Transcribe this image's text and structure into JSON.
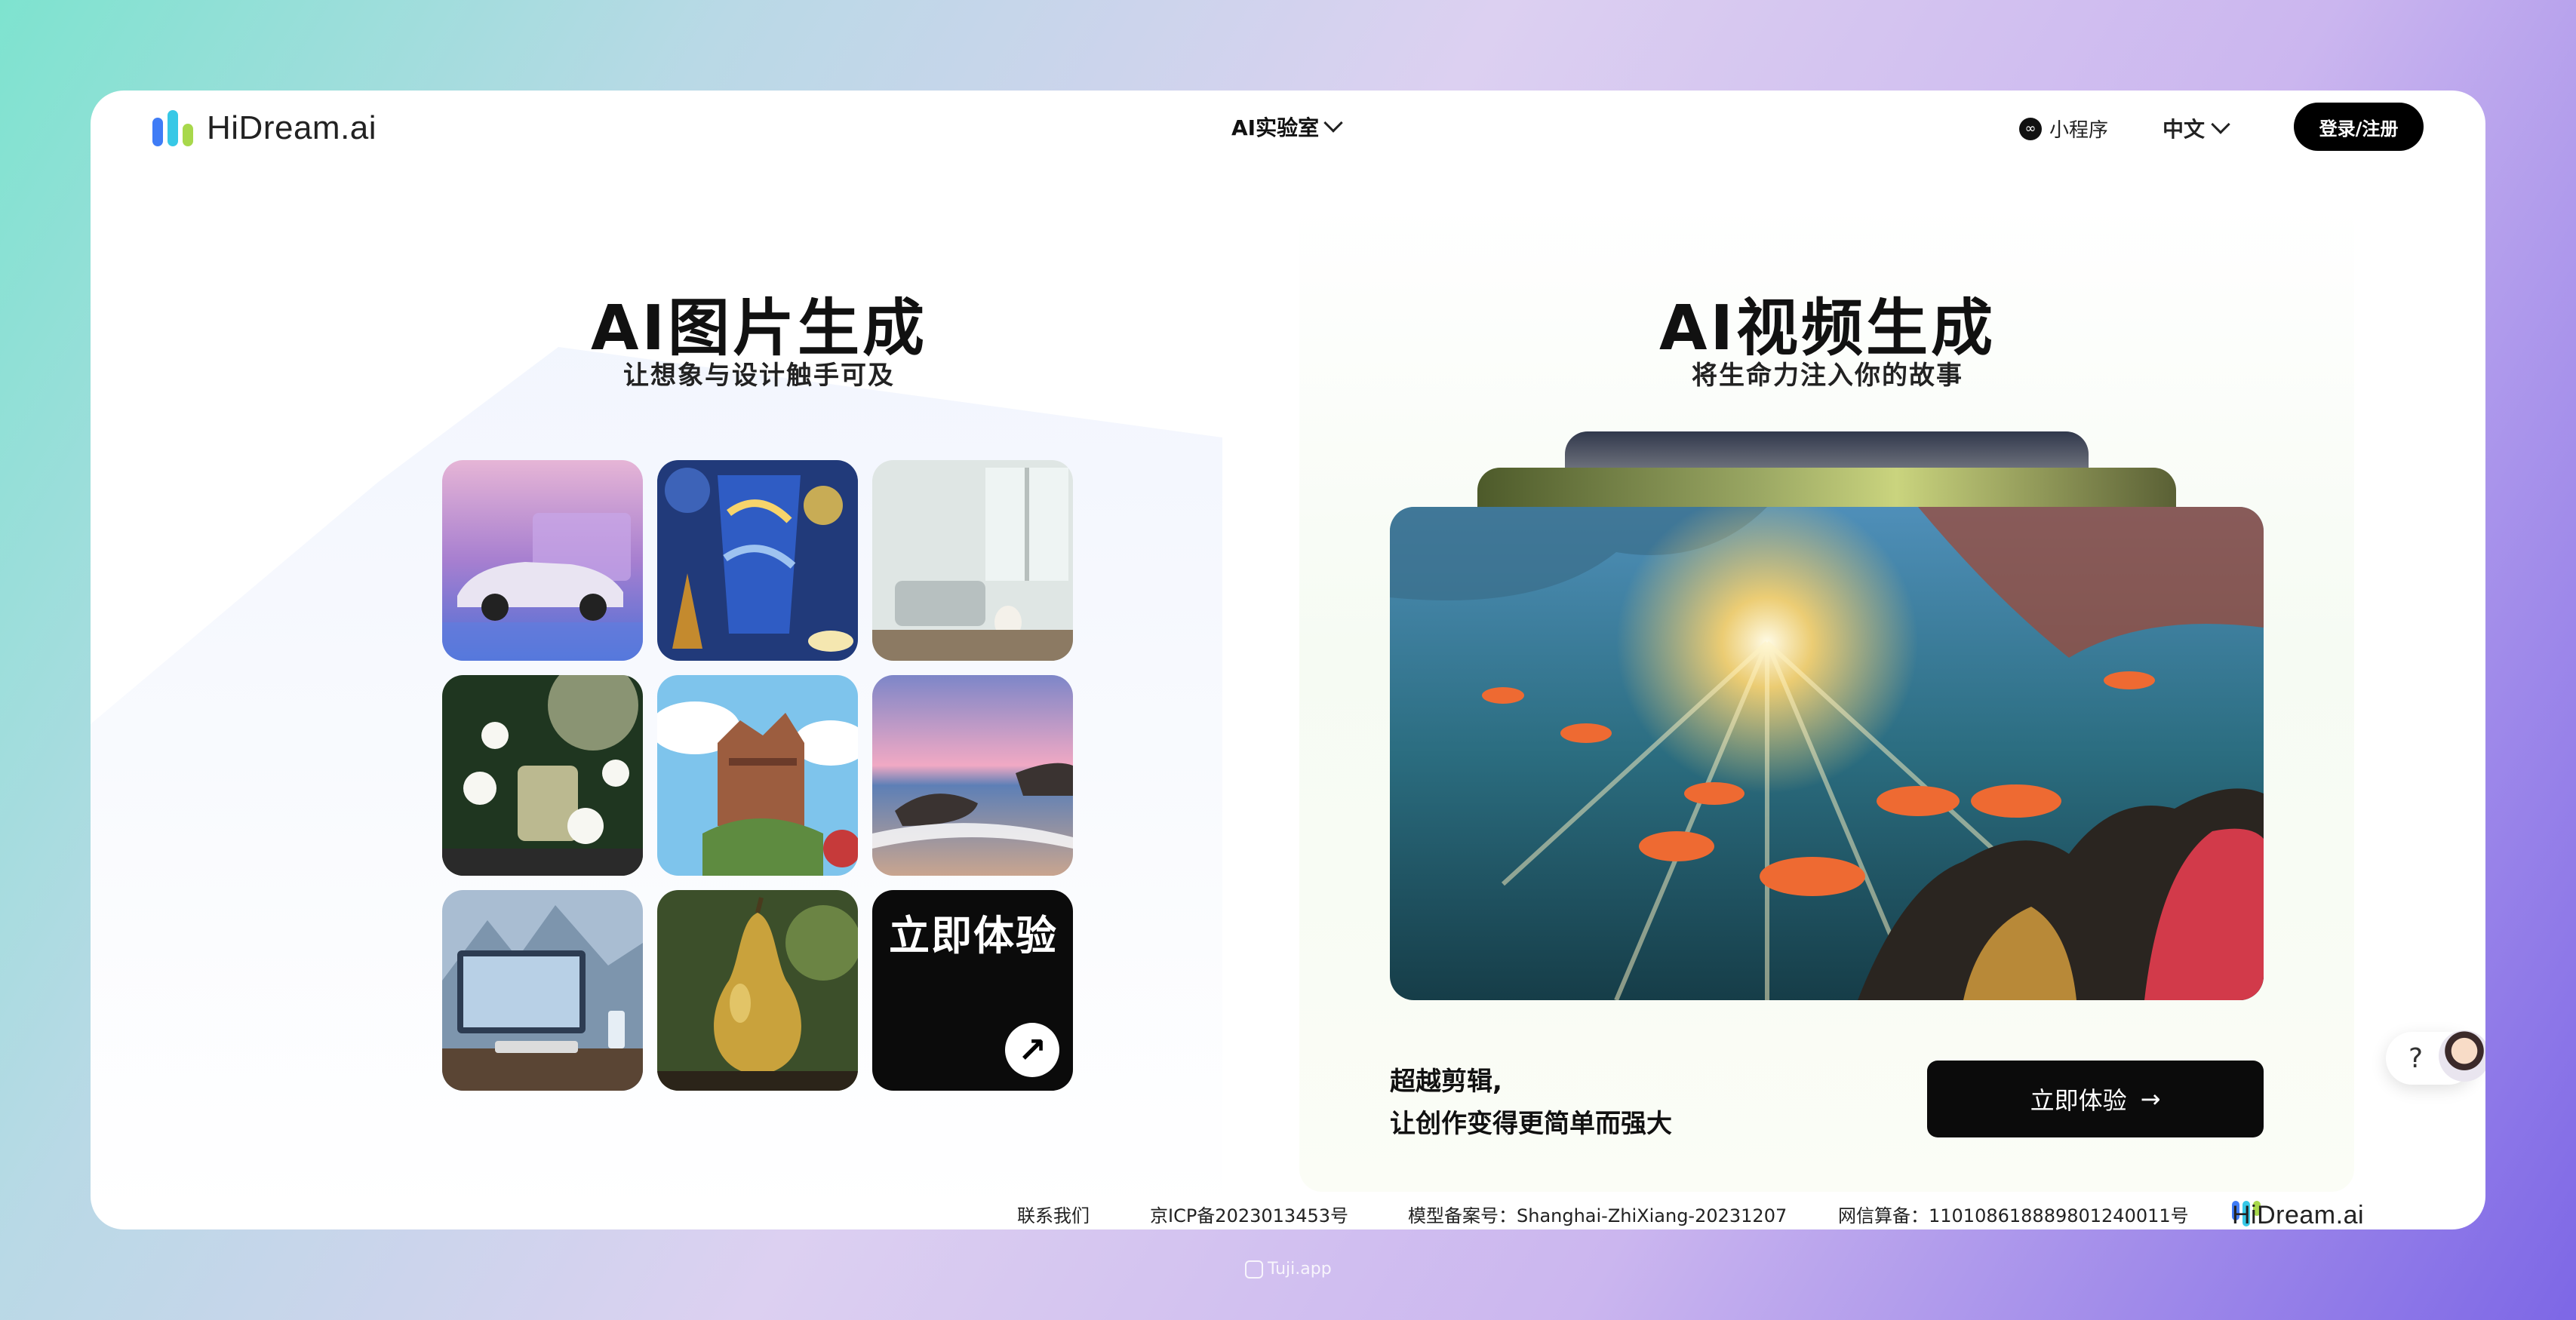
{
  "header": {
    "logo_text": "HiDream.ai",
    "nav_lab": "AI实验室",
    "mini_program": "小程序",
    "language": "中文",
    "login": "登录/注册"
  },
  "image_section": {
    "title": "AI图片生成",
    "subtitle": "让想象与设计触手可及",
    "tiles": [
      "car",
      "starry-cup",
      "living-room",
      "perfume-flowers",
      "castle",
      "beach-sunset",
      "desk-computer",
      "pear"
    ],
    "cta": "立即体验"
  },
  "video_section": {
    "title": "AI视频生成",
    "subtitle": "将生命力注入你的故事",
    "caption_line1": "超越剪辑,",
    "caption_line2": "让创作变得更简单而强大",
    "button": "立即体验"
  },
  "footer": {
    "contact": "联系我们",
    "icp": "京ICP备2023013453号",
    "model_record": "模型备案号：Shanghai-ZhiXiang-20231207",
    "net_record": "网信算备：110108618889801240011号",
    "logo_text": "HiDream.ai"
  },
  "help": {
    "label": "?"
  },
  "watermark": "Tuji.app",
  "colors": {
    "logo_blue": "#3f7cf6",
    "logo_cyan": "#37c8e6",
    "logo_green": "#a8d84b",
    "button": "#0b0b0b"
  }
}
